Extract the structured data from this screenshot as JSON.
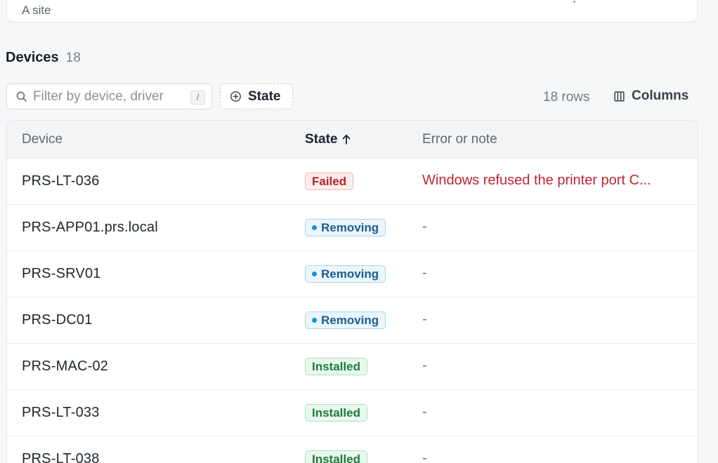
{
  "site_card": {
    "subtitle": "A site"
  },
  "section": {
    "title": "Devices",
    "count": "18"
  },
  "toolbar": {
    "search_placeholder": "Filter by device, driver",
    "search_value": "",
    "shortcut": "/",
    "state_filter_label": "State",
    "rows_label": "18 rows",
    "columns_label": "Columns"
  },
  "table": {
    "headers": {
      "device": "Device",
      "state": "State",
      "note": "Error or note"
    },
    "sort": {
      "column": "state",
      "direction": "ascending"
    },
    "rows": [
      {
        "device": "PRS-LT-036",
        "state": "Failed",
        "state_kind": "failed",
        "note": "Windows refused the printer port C...",
        "note_kind": "error"
      },
      {
        "device": "PRS-APP01.prs.local",
        "state": "Removing",
        "state_kind": "removing",
        "note": "-",
        "note_kind": "none"
      },
      {
        "device": "PRS-SRV01",
        "state": "Removing",
        "state_kind": "removing",
        "note": "-",
        "note_kind": "none"
      },
      {
        "device": "PRS-DC01",
        "state": "Removing",
        "state_kind": "removing",
        "note": "-",
        "note_kind": "none"
      },
      {
        "device": "PRS-MAC-02",
        "state": "Installed",
        "state_kind": "installed",
        "note": "-",
        "note_kind": "none"
      },
      {
        "device": "PRS-LT-033",
        "state": "Installed",
        "state_kind": "installed",
        "note": "-",
        "note_kind": "none"
      },
      {
        "device": "PRS-LT-038",
        "state": "Installed",
        "state_kind": "installed",
        "note": "-",
        "note_kind": "none"
      }
    ]
  },
  "colors": {
    "failed": "#b4232a",
    "removing": "#1b5f8f",
    "installed": "#1e7a3d",
    "error_text": "#c0262d"
  },
  "icons": {
    "search": "search-icon",
    "add_filter": "plus-circle-icon",
    "sort": "arrow-up-icon",
    "columns": "columns-icon"
  }
}
